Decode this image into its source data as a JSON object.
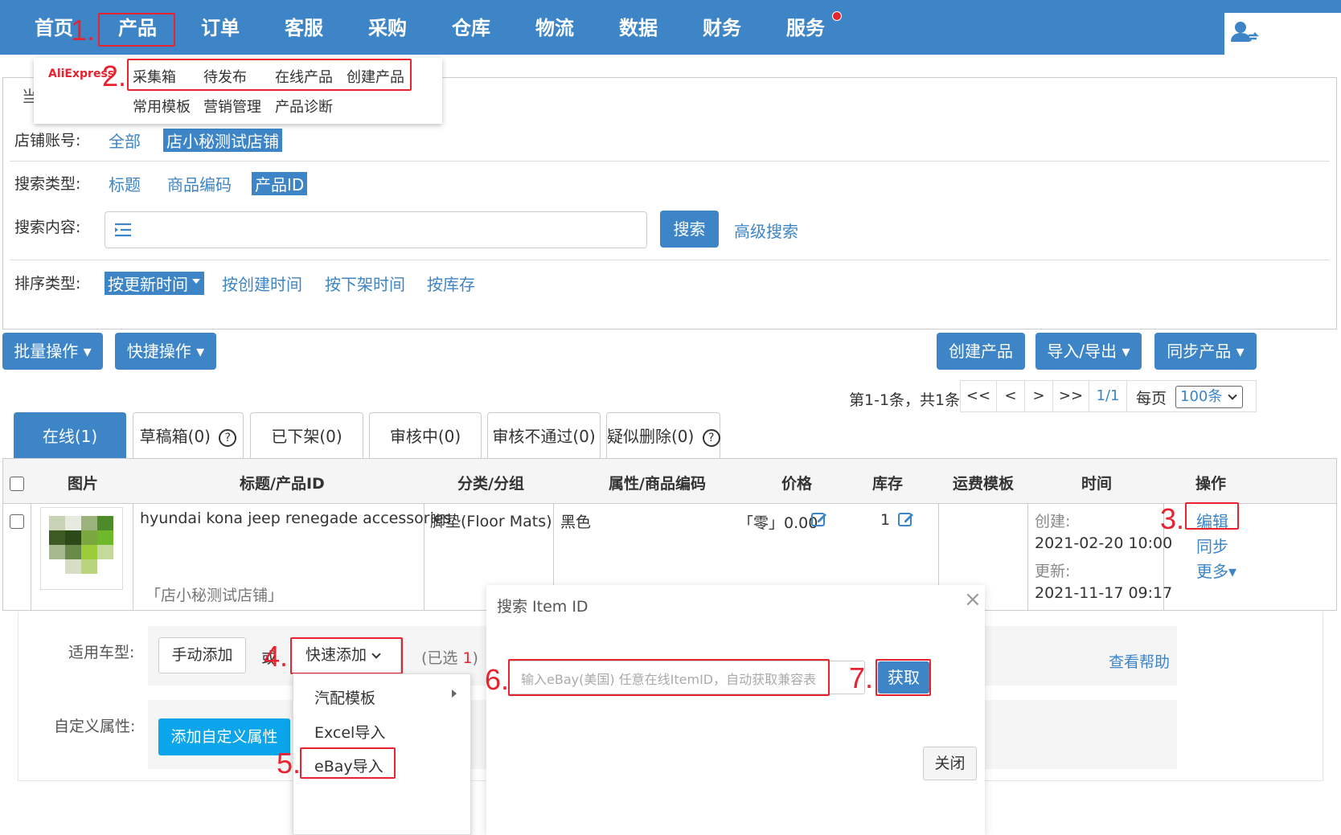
{
  "nav": {
    "items": [
      "首页",
      "产品",
      "订单",
      "客服",
      "采购",
      "仓库",
      "物流",
      "数据",
      "财务",
      "服务"
    ]
  },
  "steps": [
    "1.",
    "2.",
    "3.",
    "4.",
    "5.",
    "6.",
    "7."
  ],
  "product_menu": {
    "logo": "AliExpress",
    "row1": [
      "采集箱",
      "待发布",
      "在线产品",
      "创建产品"
    ],
    "row2": [
      "常用模板",
      "营销管理",
      "产品诊断"
    ],
    "partial_label": "当"
  },
  "filters": {
    "shop_label": "店铺账号:",
    "shop_all": "全部",
    "shop_selected": "店小秘测试店铺",
    "search_type_label": "搜索类型:",
    "search_types": [
      "标题",
      "商品编码"
    ],
    "search_type_selected": "产品ID",
    "search_content_label": "搜索内容:",
    "search_button": "搜索",
    "advanced_search": "高级搜索",
    "sort_label": "排序类型:",
    "sort_selected": "按更新时间",
    "sort_options": [
      "按创建时间",
      "按下架时间",
      "按库存"
    ]
  },
  "toolbar": {
    "batch": "批量操作 ▾",
    "quick": "快捷操作 ▾",
    "create": "创建产品",
    "import_export": "导入/导出 ▾",
    "sync": "同步产品 ▾"
  },
  "pager": {
    "summary": "第1-1条，共1条",
    "first": "<<",
    "prev": "<",
    "next": ">",
    "last": ">>",
    "page": "1/1",
    "per_page_label": "每页",
    "per_page_value": "100条"
  },
  "tabs": [
    "在线(1)",
    "草稿箱(0)",
    "已下架(0)",
    "审核中(0)",
    "审核不通过(0)",
    "疑似删除(0)"
  ],
  "table": {
    "headers": [
      "图片",
      "标题/产品ID",
      "分类/分组",
      "属性/商品编码",
      "价格",
      "库存",
      "运费模板",
      "时间",
      "操作"
    ],
    "row": {
      "title": "hyundai kona jeep renegade accessories",
      "shop": "「店小秘测试店铺」",
      "category": "脚垫(Floor Mats)",
      "attribute": "黑色",
      "price": "「零」0.00",
      "stock": "1",
      "created_label": "创建:",
      "created": "2021-02-20 10:00",
      "updated_label": "更新:",
      "updated": "2021-11-17 09:17",
      "actions": [
        "编辑",
        "同步",
        "更多▾"
      ]
    }
  },
  "vehicle": {
    "label": "适用车型:",
    "manual_add": "手动添加",
    "or": "或",
    "quick_add": "快速添加",
    "selected_prefix": "(已选 ",
    "selected_count": "1",
    "selected_suffix": ")",
    "help": "查看帮助",
    "quick_menu": [
      "汽配模板",
      "Excel导入",
      "eBay导入"
    ]
  },
  "custom_attr": {
    "label": "自定义属性:",
    "button": "添加自定义属性"
  },
  "modal": {
    "title": "搜索 Item ID",
    "close": "×",
    "placeholder": "输入eBay(美国) 任意在线ItemID，自动获取兼容表",
    "fetch": "获取",
    "close_button": "关闭"
  }
}
